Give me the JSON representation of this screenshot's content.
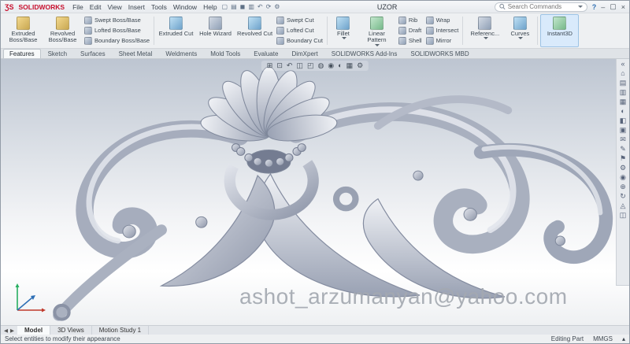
{
  "title_bar": {
    "logo_glyph": "ƷS",
    "app_name": "SOLIDWORKS",
    "menu": [
      "File",
      "Edit",
      "View",
      "Insert",
      "Tools",
      "Window",
      "Help"
    ],
    "quick_access": [
      {
        "name": "new-file-icon",
        "glyph": "▢"
      },
      {
        "name": "open-file-icon",
        "glyph": "▤"
      },
      {
        "name": "save-icon",
        "glyph": "◼"
      },
      {
        "name": "print-icon",
        "glyph": "▥"
      },
      {
        "name": "undo-icon",
        "glyph": "↶"
      },
      {
        "name": "rebuild-icon",
        "glyph": "⟳"
      },
      {
        "name": "options-icon",
        "glyph": "⚙"
      }
    ],
    "document_title": "UZOR",
    "search": {
      "placeholder": "Search Commands"
    },
    "window_controls": {
      "help": "?",
      "minimize": "–",
      "maximize": "▢",
      "close": "×"
    }
  },
  "ribbon": {
    "groups": [
      {
        "labels": [
          "Extruded Boss/Base",
          "Revolved Boss/Base",
          "Swept Boss/Base",
          "Lofted Boss/Base",
          "Boundary Boss/Base"
        ]
      },
      {
        "labels": [
          "Extruded Cut",
          "Hole Wizard",
          "Revolved Cut",
          "Swept Cut",
          "Lofted Cut",
          "Boundary Cut"
        ]
      },
      {
        "labels": [
          "Fillet",
          "Linear Pattern",
          "Rib",
          "Draft",
          "Shell",
          "Wrap",
          "Intersect",
          "Mirror"
        ]
      },
      {
        "labels": [
          "Referenc...",
          "Curves"
        ]
      },
      {
        "labels": [
          "Instant3D"
        ]
      }
    ]
  },
  "command_tabs": {
    "items": [
      "Features",
      "Sketch",
      "Surfaces",
      "Sheet Metal",
      "Weldments",
      "Mold Tools",
      "Evaluate",
      "DimXpert",
      "SOLIDWORKS Add-Ins",
      "SOLIDWORKS MBD"
    ],
    "active": "Features"
  },
  "viewport": {
    "headsup": [
      {
        "name": "zoom-fit-icon",
        "glyph": "⊞"
      },
      {
        "name": "zoom-area-icon",
        "glyph": "⊡"
      },
      {
        "name": "previous-view-icon",
        "glyph": "↶"
      },
      {
        "name": "section-view-icon",
        "glyph": "◫"
      },
      {
        "name": "view-orientation-icon",
        "glyph": "◰"
      },
      {
        "name": "display-style-icon",
        "glyph": "◍"
      },
      {
        "name": "hide-show-items-icon",
        "glyph": "◉"
      },
      {
        "name": "edit-appearance-icon",
        "glyph": "◐"
      },
      {
        "name": "apply-scene-icon",
        "glyph": "▦"
      },
      {
        "name": "view-settings-icon",
        "glyph": "⚙"
      }
    ],
    "right_toolbar": [
      {
        "name": "collapse-arrows-icon",
        "glyph": "«"
      },
      {
        "name": "home-icon",
        "glyph": "⌂"
      },
      {
        "name": "design-library-icon",
        "glyph": "▤"
      },
      {
        "name": "file-explorer-icon",
        "glyph": "▥"
      },
      {
        "name": "view-palette-icon",
        "glyph": "▦"
      },
      {
        "name": "appearances-icon",
        "glyph": "◐"
      },
      {
        "name": "scene-icon",
        "glyph": "◧"
      },
      {
        "name": "custom-properties-icon",
        "glyph": "▣"
      },
      {
        "name": "forum-icon",
        "glyph": "✉"
      },
      {
        "name": "pencil-icon",
        "glyph": "✎"
      },
      {
        "name": "flag-icon",
        "glyph": "⚑"
      },
      {
        "name": "gear-icon",
        "glyph": "⚙"
      },
      {
        "name": "target-icon",
        "glyph": "◉"
      },
      {
        "name": "plus-icon",
        "glyph": "⊕"
      },
      {
        "name": "refresh-icon",
        "glyph": "↻"
      },
      {
        "name": "triangle-icon",
        "glyph": "◬"
      },
      {
        "name": "section-icon",
        "glyph": "◫"
      }
    ],
    "watermark": "ashot_arzumanyan@yahoo.com"
  },
  "bottom_tabs": {
    "nav": [
      "◀",
      "▶"
    ],
    "items": [
      "Model",
      "3D Views",
      "Motion Study 1"
    ],
    "active": "Model"
  },
  "status_bar": {
    "left_text": "Select entities to modify their appearance",
    "mode": "Editing Part",
    "units": "MMGS",
    "caret": "▴"
  }
}
